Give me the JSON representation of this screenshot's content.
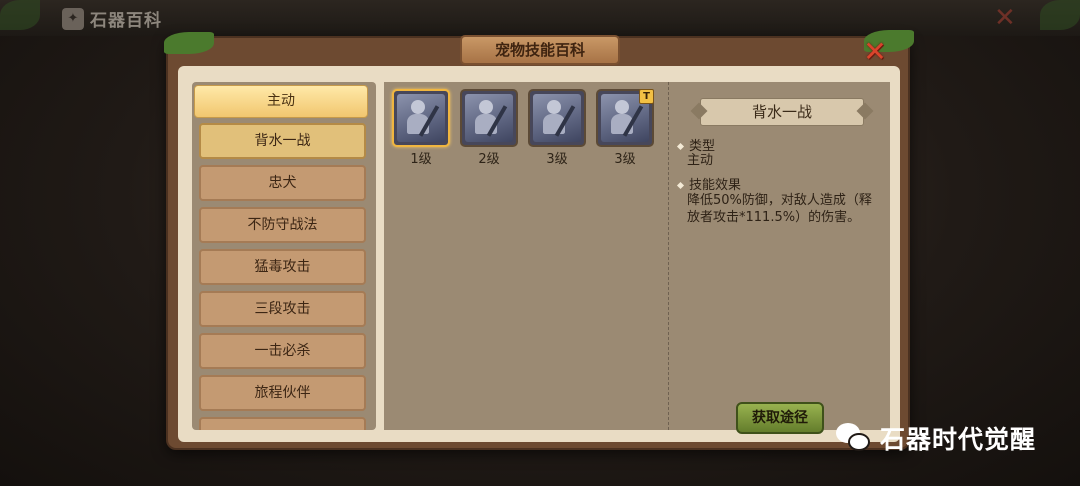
{
  "topbar": {
    "app_title": "石器百科"
  },
  "window": {
    "title": "宠物技能百科"
  },
  "sidebar": {
    "category": "主动",
    "items": [
      {
        "label": "背水一战",
        "selected": true
      },
      {
        "label": "忠犬",
        "selected": false
      },
      {
        "label": "不防守战法",
        "selected": false
      },
      {
        "label": "猛毒攻击",
        "selected": false
      },
      {
        "label": "三段攻击",
        "selected": false
      },
      {
        "label": "一击必杀",
        "selected": false
      },
      {
        "label": "旅程伙伴",
        "selected": false
      }
    ]
  },
  "levels": [
    {
      "label": "1级",
      "selected": true,
      "badge": ""
    },
    {
      "label": "2级",
      "selected": false,
      "badge": ""
    },
    {
      "label": "3级",
      "selected": false,
      "badge": ""
    },
    {
      "label": "3级",
      "selected": false,
      "badge": "T"
    }
  ],
  "detail": {
    "title": "背水一战",
    "type_heading": "类型",
    "type_value": "主动",
    "effect_heading": "技能效果",
    "effect_text": "降低50%防御，对敌人造成（释放者攻击*111.5%）的伤害。",
    "source_button": "获取途径"
  },
  "watermark": {
    "text": "石器时代觉醒"
  }
}
